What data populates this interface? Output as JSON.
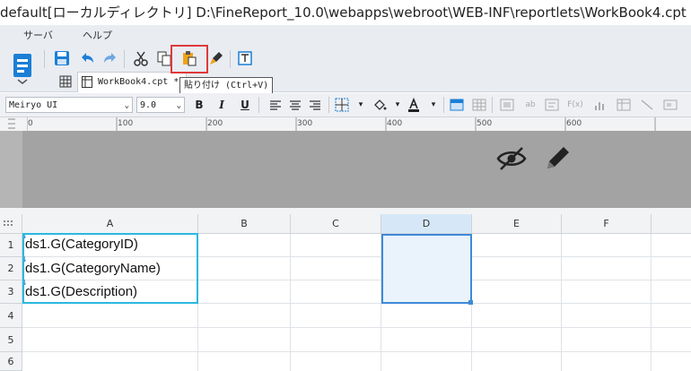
{
  "title_bar": {
    "text": "default[ローカルディレクトリ]    D:\\FineReport_10.0\\webapps\\webroot\\WEB-INF\\reportlets\\WorkBook4.cpt"
  },
  "menu": {
    "items": [
      {
        "label": "サーバ"
      },
      {
        "label": "ヘルプ"
      }
    ]
  },
  "tab": {
    "label": "WorkBook4.cpt *"
  },
  "tooltip": {
    "text": "貼り付け (Ctrl+V)"
  },
  "format_bar": {
    "font": "Meiryo UI",
    "size": "9.0",
    "bold": "B",
    "italic": "I",
    "underline": "U"
  },
  "ruler": {
    "ticks": [
      "0",
      "100",
      "200",
      "300",
      "400",
      "500",
      "600"
    ]
  },
  "columns": [
    {
      "label": "A"
    },
    {
      "label": "B"
    },
    {
      "label": "C"
    },
    {
      "label": "D"
    },
    {
      "label": "E"
    },
    {
      "label": "F"
    }
  ],
  "rows": [
    "1",
    "2",
    "3",
    "4",
    "5",
    "6"
  ],
  "cells": {
    "a1": "ds1.G(CategoryID)",
    "a2": "ds1.G(CategoryName)",
    "a3": "ds1.G(Description)"
  },
  "colors": {
    "accent": "#1b7fd6",
    "selection": "#2bb8e0",
    "highlight": "#e03a3a",
    "band": "#a3a3a3"
  }
}
